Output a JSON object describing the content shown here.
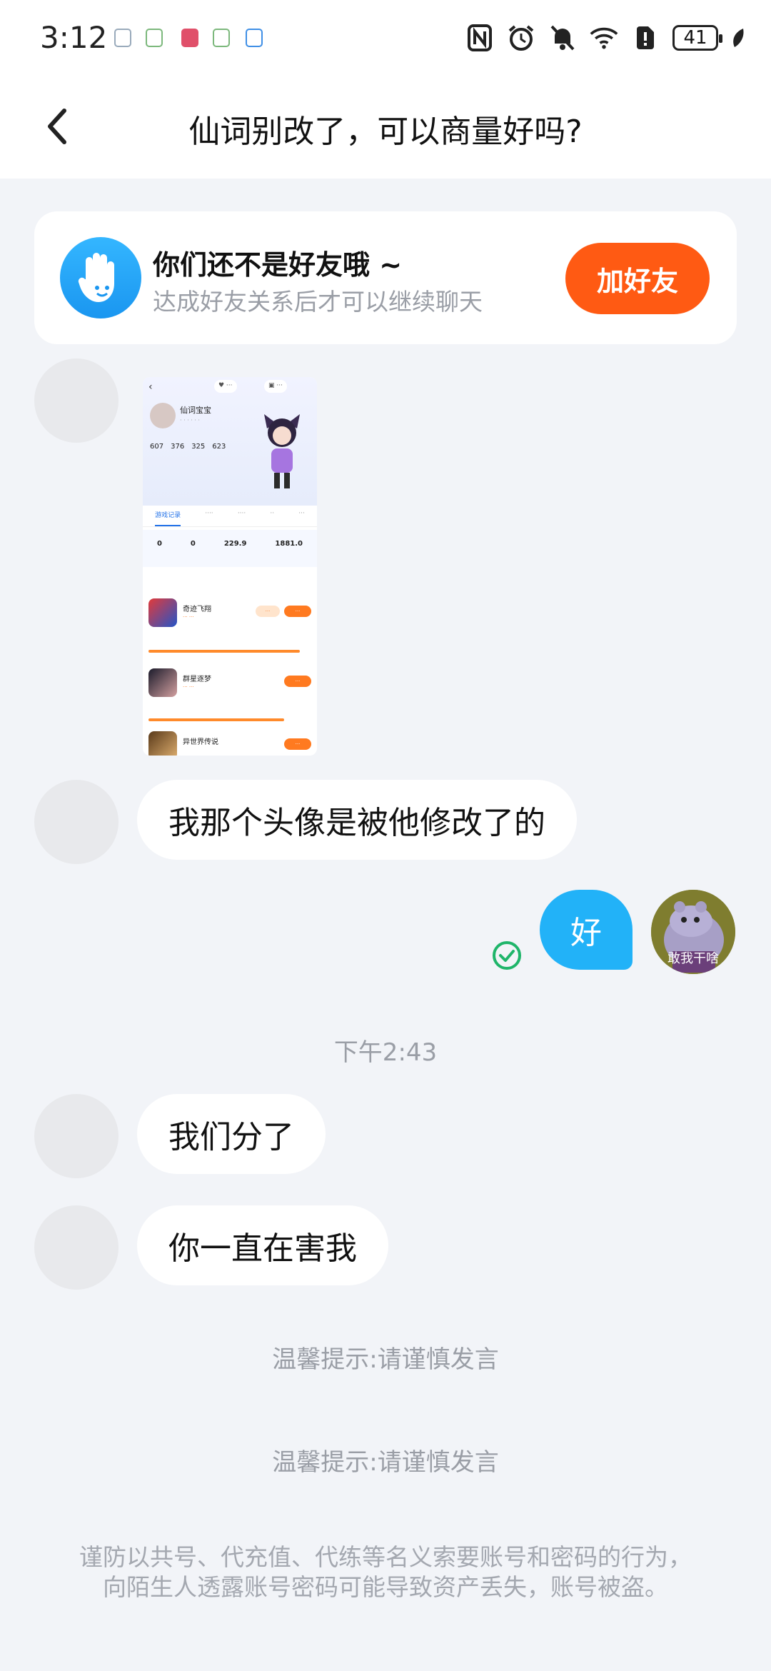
{
  "status_bar": {
    "time": "3:12",
    "battery": "41"
  },
  "header": {
    "title": "仙词别改了，可以商量好吗?"
  },
  "banner": {
    "title": "你们还不是好友哦 ~",
    "subtitle": "达成好友关系后才可以继续聊天",
    "button": "加好友"
  },
  "screenshot": {
    "profile_name": "仙词宝宝",
    "stats": [
      "607",
      "376",
      "325",
      "623"
    ],
    "tab_first": "游戏记录",
    "row_values": [
      "0",
      "0",
      "229.9",
      "1881.0"
    ],
    "games": [
      "奇迹飞翔",
      "群星逐梦",
      "异世界传说"
    ]
  },
  "messages": [
    {
      "from": "other",
      "text": "我那个头像是被他修改了的"
    },
    {
      "from": "me",
      "text": "好"
    },
    {
      "from": "other",
      "text": "我们分了"
    },
    {
      "from": "other",
      "text": "你一直在害我"
    }
  ],
  "my_avatar_caption": "敢我干啥",
  "timestamp": "下午2:43",
  "tips": [
    "温馨提示:请谨慎发言",
    "温馨提示:请谨慎发言"
  ],
  "warning": "谨防以共号、代充值、代练等名义索要账号和密码的行为，向陌生人透露账号密码可能导致资产丢失，账号被盗。",
  "colors": {
    "accent_orange": "#ff5a13",
    "my_bubble": "#22b2f8",
    "background": "#f2f4f8"
  }
}
